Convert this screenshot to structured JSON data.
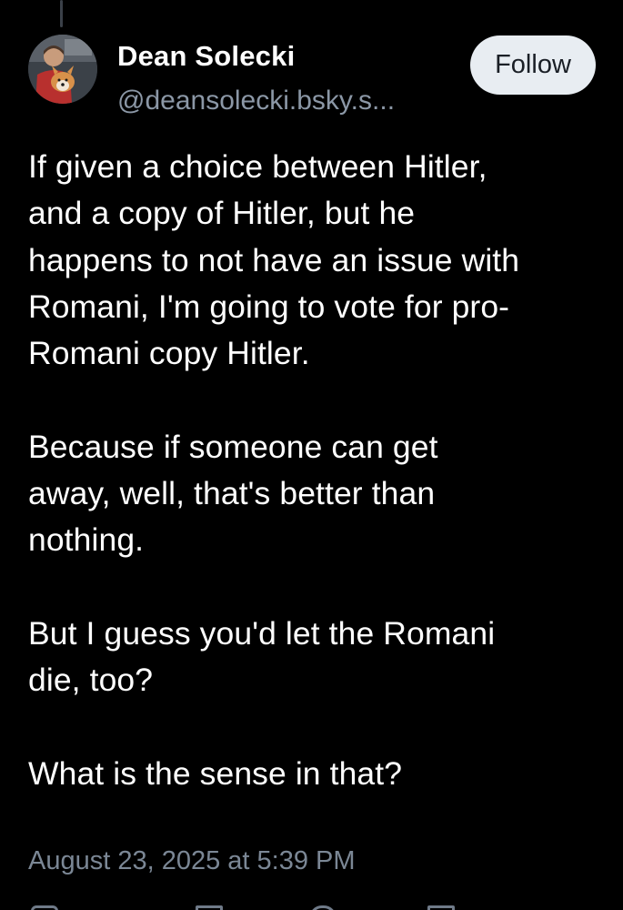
{
  "post": {
    "author": {
      "display_name": "Dean Solecki",
      "handle": "@deansolecki.bsky.s..."
    },
    "follow_label": "Follow",
    "paragraphs": [
      [
        "If given a choice between Hitler,",
        "and a copy of Hitler, but he",
        "happens to not have an issue with",
        "Romani, I'm going to vote for pro-",
        "Romani copy Hitler."
      ],
      [
        "Because if someone can get",
        "away, well, that's better than",
        "nothing."
      ],
      [
        "But I guess you'd let the Romani",
        "die, too?"
      ],
      [
        "What is the sense in that?"
      ]
    ],
    "timestamp": "August 23, 2025 at 5:39 PM"
  },
  "icons": {
    "avatar": "profile-photo-with-dog",
    "actions": [
      "reply-icon",
      "repost-icon",
      "like-icon",
      "share-icon"
    ]
  },
  "colors": {
    "background": "#000000",
    "text": "#ffffff",
    "muted": "#8b97a6",
    "follow_bg": "#e8edf2"
  }
}
